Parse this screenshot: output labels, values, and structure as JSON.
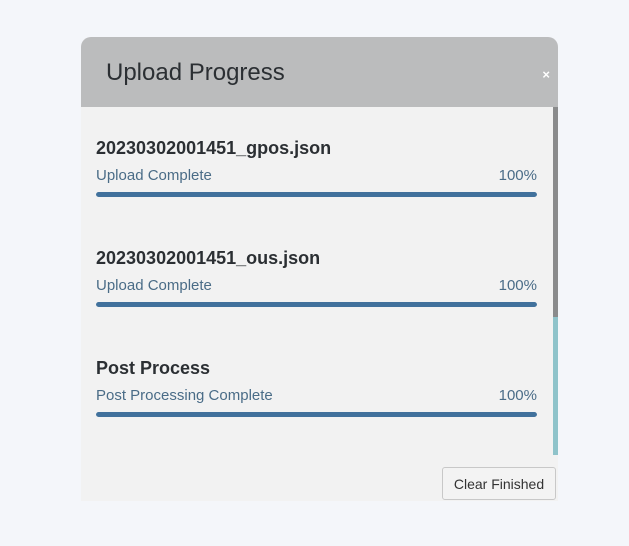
{
  "dialog": {
    "title": "Upload Progress",
    "close_label": "×"
  },
  "items": [
    {
      "name": "20230302001451_gpos.json",
      "status": "Upload Complete",
      "percent_label": "100%",
      "progress": 1.0
    },
    {
      "name": "20230302001451_ous.json",
      "status": "Upload Complete",
      "percent_label": "100%",
      "progress": 1.0
    },
    {
      "name": "Post Process",
      "status": "Post Processing Complete",
      "percent_label": "100%",
      "progress": 1.0
    }
  ],
  "footer": {
    "clear_button_label": "Clear Finished"
  },
  "colors": {
    "header_bg": "#bbbcbd",
    "progress_fill": "#41719c",
    "status_text": "#4a6c87"
  }
}
